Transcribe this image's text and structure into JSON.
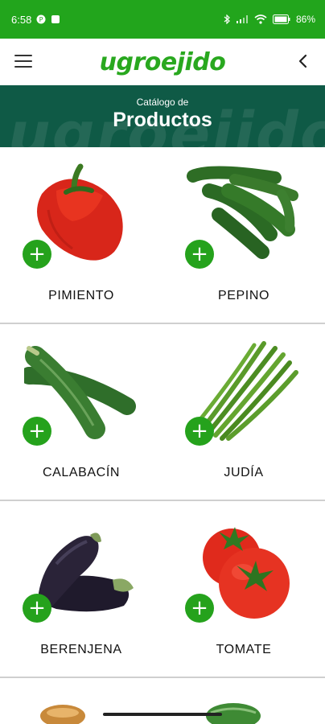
{
  "status_bar": {
    "time": "6:58",
    "battery": "86"
  },
  "app": {
    "logo_text": "ugroejido"
  },
  "banner": {
    "subtitle": "Catálogo de",
    "title": "Productos",
    "watermark": "ugroejido"
  },
  "add_label": "+",
  "products": [
    {
      "name": "PIMIENTO"
    },
    {
      "name": "PEPINO"
    },
    {
      "name": "CALABACÍN"
    },
    {
      "name": "JUDÍA"
    },
    {
      "name": "BERENJENA"
    },
    {
      "name": "TOMATE"
    }
  ],
  "colors": {
    "primary_green": "#22a51c",
    "banner_green": "#0f5a46"
  }
}
